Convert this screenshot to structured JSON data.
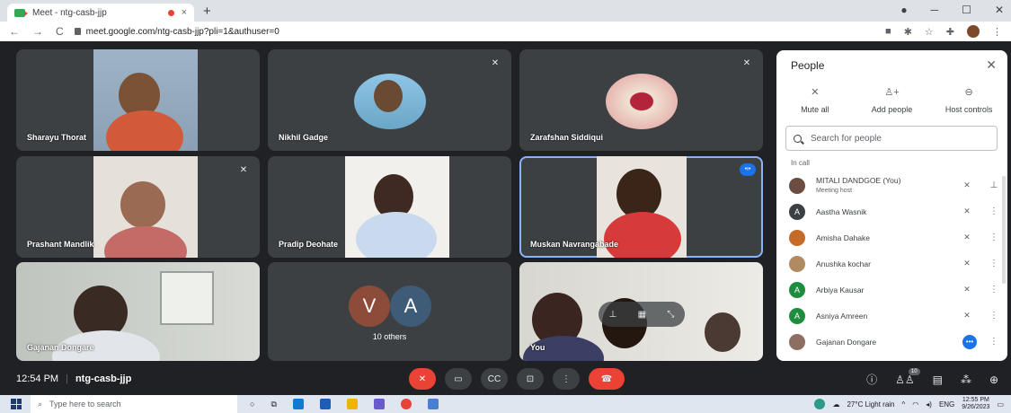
{
  "browser": {
    "tab_title": "Meet - ntg-casb-jjp",
    "tab_close": "×",
    "new_tab": "+",
    "url": "meet.google.com/ntg-casb-jjp?pli=1&authuser=0",
    "window_controls": [
      "●",
      "─",
      "☐",
      "✕"
    ]
  },
  "tiles": [
    {
      "name": "Sharayu Thorat",
      "muted": false
    },
    {
      "name": "Nikhil Gadge",
      "muted": true
    },
    {
      "name": "Zarafshan Siddiqui",
      "muted": true
    },
    {
      "name": "Prashant Mandlik",
      "muted": true
    },
    {
      "name": "Pradip Deohate",
      "muted": false
    },
    {
      "name": "Muskan Navrangabade",
      "muted": false,
      "speaking": true
    },
    {
      "name": "Gajanan Dongare",
      "muted": false
    },
    {
      "name": "10 others",
      "muted": false,
      "initials": [
        "V",
        "A"
      ]
    },
    {
      "name": "You",
      "muted": true
    }
  ],
  "panel": {
    "title": "People",
    "close": "✕",
    "actions": [
      {
        "label": "Mute all",
        "icon": "mic-off-icon"
      },
      {
        "label": "Add people",
        "icon": "person-add-icon"
      },
      {
        "label": "Host controls",
        "icon": "toggle-icon"
      }
    ],
    "search_placeholder": "Search for people",
    "section": "In call",
    "people": [
      {
        "name": "MITALI DANDGOE (You)",
        "sub": "Meeting host",
        "initial": "",
        "color": "#6d4c41",
        "more": "pin"
      },
      {
        "name": "Aastha Wasnik",
        "sub": "",
        "initial": "A",
        "color": "#3c4043",
        "more": "dots"
      },
      {
        "name": "Amisha Dahake",
        "sub": "",
        "initial": "",
        "color": "#c56a28",
        "more": "dots"
      },
      {
        "name": "Anushka kochar",
        "sub": "",
        "initial": "",
        "color": "#b08a60",
        "more": "dots"
      },
      {
        "name": "Arbiya Kausar",
        "sub": "",
        "initial": "A",
        "color": "#1e8e3e",
        "more": "dots"
      },
      {
        "name": "Asniya Amreen",
        "sub": "",
        "initial": "A",
        "color": "#1e8e3e",
        "more": "dots"
      },
      {
        "name": "Gajanan Dongare",
        "sub": "",
        "initial": "",
        "color": "#8d6e63",
        "more": "dots",
        "active": true
      }
    ]
  },
  "controls": {
    "time": "12:54 PM",
    "separator": "|",
    "meeting_code": "ntg-casb-jjp",
    "participant_count": "10"
  },
  "taskbar": {
    "search_placeholder": "Type here to search",
    "weather": "27°C  Light rain",
    "lang": "ENG",
    "time": "12:55 PM",
    "date": "9/26/2023"
  },
  "colors": {
    "meet_bg": "#202124",
    "tile_bg": "#3c4043",
    "accent": "#8ab4f8",
    "danger": "#ea4335"
  }
}
